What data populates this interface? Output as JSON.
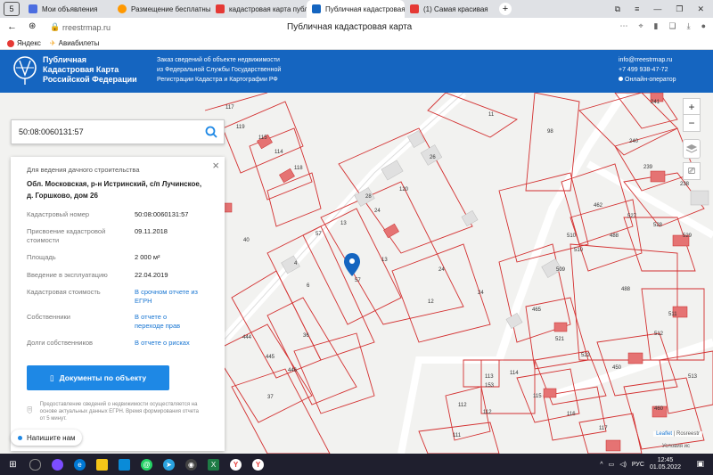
{
  "browser": {
    "tabs": [
      {
        "label": "Мои объявления",
        "favicon_color": "#4b6de0"
      },
      {
        "label": "Размещение бесплатных",
        "favicon_color": "#ff9800"
      },
      {
        "label": "кадастровая карта публи",
        "favicon_color": "#e53935"
      },
      {
        "label": "Публичная кадастровая",
        "favicon_color": "#1565c0",
        "active": true
      },
      {
        "label": "(1) Самая красивая",
        "favicon_color": "#e53935"
      }
    ],
    "new_tab": "+",
    "url": "rreestrmap.ru",
    "page_title": "Публичная кадастровая карта",
    "bookmarks": [
      {
        "label": "Яндекс",
        "color": "#e53935"
      },
      {
        "label": "Авиабилеты",
        "color": "#f5a623"
      }
    ]
  },
  "site": {
    "brand": [
      "Публичная",
      "Кадастровая Карта",
      "Российской Федерации"
    ],
    "info": [
      "Заказ сведений об объекте недвижимости",
      "из Федеральной Службы Государственной",
      "Регистрации Кадастра и Картографии РФ"
    ],
    "email": "info@rreestrmap.ru",
    "phone": "+7 499 938-47-72",
    "online_operator": "Онлайн-оператор"
  },
  "search": {
    "value": "50:08:0060131:57"
  },
  "panel": {
    "purpose": "Для ведения дачного строительства",
    "address": "Обл. Московская, р-н Истринский, с/п Лучинское, д. Горшково, дом 26",
    "rows": [
      {
        "label": "Кадастровый номер",
        "value": "50:08:0060131:57"
      },
      {
        "label": "Присвоение кадастровой стоимости",
        "value": "09.11.2018"
      },
      {
        "label": "Площадь",
        "value": "2 000 м²"
      },
      {
        "label": "Введение в эксплуатацию",
        "value": "22.04.2019"
      },
      {
        "label": "Кадастровая стоимость",
        "value": "В срочном отчете из ЕГРН"
      },
      {
        "label": "Собственники",
        "value": "В отчете о переходе прав"
      },
      {
        "label": "Долги собственников",
        "value": "В отчете о рисках"
      }
    ],
    "docs_button": "Документы по объекту",
    "disclaimer": "Предоставление сведений о недвижимости осуществляется на основе актуальных данных ЕГРН. Время формирования отчета от 5 минут."
  },
  "chat": {
    "label": "Напишите нам"
  },
  "map": {
    "zoom_in": "+",
    "zoom_out": "−",
    "attribution_leaflet": "Leaflet",
    "attribution_rosreestr": "Rosreestr",
    "attribution_terms": "Условия ис",
    "parcel_labels": [
      "117",
      "119",
      "115",
      "114",
      "118",
      "11",
      "98",
      "26",
      "120",
      "28",
      "24",
      "13",
      "57",
      "13",
      "24",
      "12",
      "6",
      "4",
      "57",
      "36",
      "40",
      "444",
      "445",
      "446",
      "37",
      "240",
      "241",
      "239",
      "238",
      "462",
      "527",
      "528",
      "529",
      "510",
      "510",
      "488",
      "509",
      "488",
      "465",
      "511",
      "512",
      "522",
      "450",
      "521",
      "513",
      "460",
      "114",
      "113",
      "153",
      "115",
      "116",
      "112",
      "112",
      "111",
      "117",
      "24"
    ]
  },
  "taskbar": {
    "lang": "РУС",
    "time": "12:45",
    "date": "01.05.2022"
  }
}
